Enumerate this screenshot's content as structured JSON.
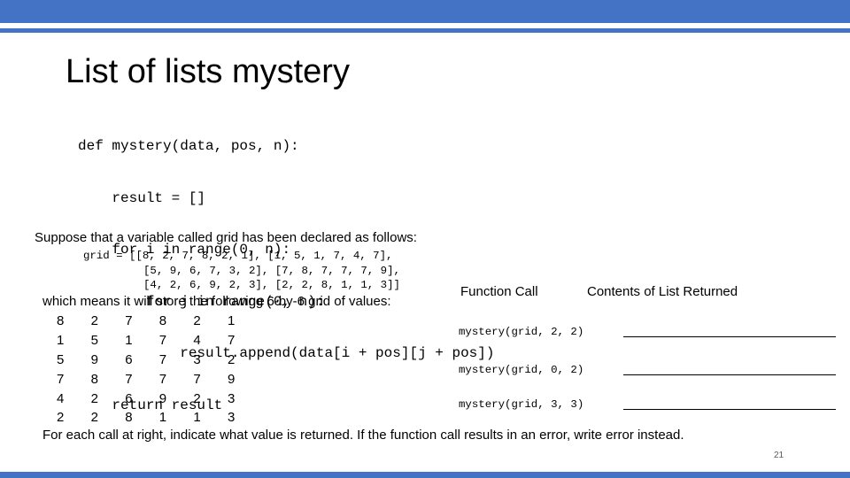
{
  "slide": {
    "title": "List of lists mystery",
    "code_lines": [
      "def mystery(data, pos, n):",
      "    result = []",
      "    for i in range(0, n):",
      "        for j in range(0, n):",
      "            result.append(data[i + pos][j + pos])",
      "    return result"
    ],
    "suppose_text": "Suppose that a variable called grid has been declared as follows:",
    "declaration_lines": [
      "grid = [[8, 2, 7, 8, 2, 1], [1, 5, 1, 7, 4, 7],",
      "[5, 9, 6, 7, 3, 2], [7, 8, 7, 7, 7, 9],",
      "[4, 2, 6, 9, 2, 3], [2, 2, 8, 1, 1, 3]]"
    ],
    "which_text": "which means it will store the following 6-by-6 grid of values:",
    "grid": [
      [
        "8",
        "2",
        "7",
        "8",
        "2",
        "1"
      ],
      [
        "1",
        "5",
        "1",
        "7",
        "4",
        "7"
      ],
      [
        "5",
        "9",
        "6",
        "7",
        "3",
        "2"
      ],
      [
        "7",
        "8",
        "7",
        "7",
        "7",
        "9"
      ],
      [
        "4",
        "2",
        "6",
        "9",
        "2",
        "3"
      ],
      [
        "2",
        "2",
        "8",
        "1",
        "1",
        "3"
      ]
    ],
    "table_headers": {
      "call": "Function Call",
      "contents": "Contents of List Returned"
    },
    "calls": [
      "mystery(grid, 2, 2)",
      "mystery(grid, 0, 2)",
      "mystery(grid, 3, 3)"
    ],
    "instructions": "For each call at right, indicate what value is returned.  If the function call results in an error, write error instead.",
    "page_number": "21",
    "colors": {
      "accent": "#4472c4",
      "page_number": "#595959"
    }
  }
}
